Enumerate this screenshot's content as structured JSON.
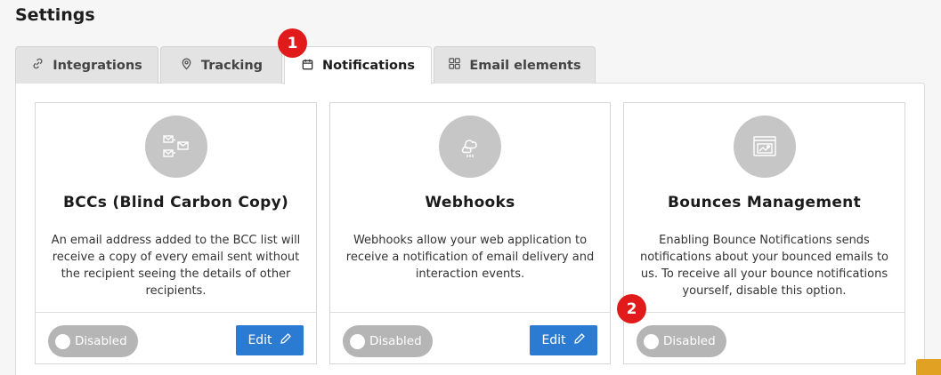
{
  "page": {
    "title": "Settings"
  },
  "tabs": [
    {
      "label": "Integrations",
      "icon": "link-icon"
    },
    {
      "label": "Tracking",
      "icon": "location-pin-icon"
    },
    {
      "label": "Notifications",
      "icon": "calendar-icon",
      "active": true
    },
    {
      "label": "Email elements",
      "icon": "grid-icon"
    }
  ],
  "cards": [
    {
      "icon": "envelopes-icon",
      "title": "BCCs (Blind Carbon Copy)",
      "description": "An email address added to the BCC list will receive a copy of every email sent without the recipient seeing the details of other recipients.",
      "toggle_label": "Disabled",
      "edit_label": "Edit"
    },
    {
      "icon": "webhook-cloud-icon",
      "title": "Webhooks",
      "description": "Webhooks allow your web application to receive a notification of email delivery and interaction events.",
      "toggle_label": "Disabled",
      "edit_label": "Edit"
    },
    {
      "icon": "bounce-window-icon",
      "title": "Bounces Management",
      "description": "Enabling Bounce Notifications sends notifications about your bounced emails to us. To receive all your bounce notifications yourself, disable this option.",
      "toggle_label": "Disabled"
    }
  ],
  "markers": [
    "1",
    "2"
  ],
  "colors": {
    "accent": "#2b7bd3",
    "marker": "#e11b1b",
    "toggle_off": "#b5b5b5",
    "icon_circle": "#c6c6c6"
  }
}
